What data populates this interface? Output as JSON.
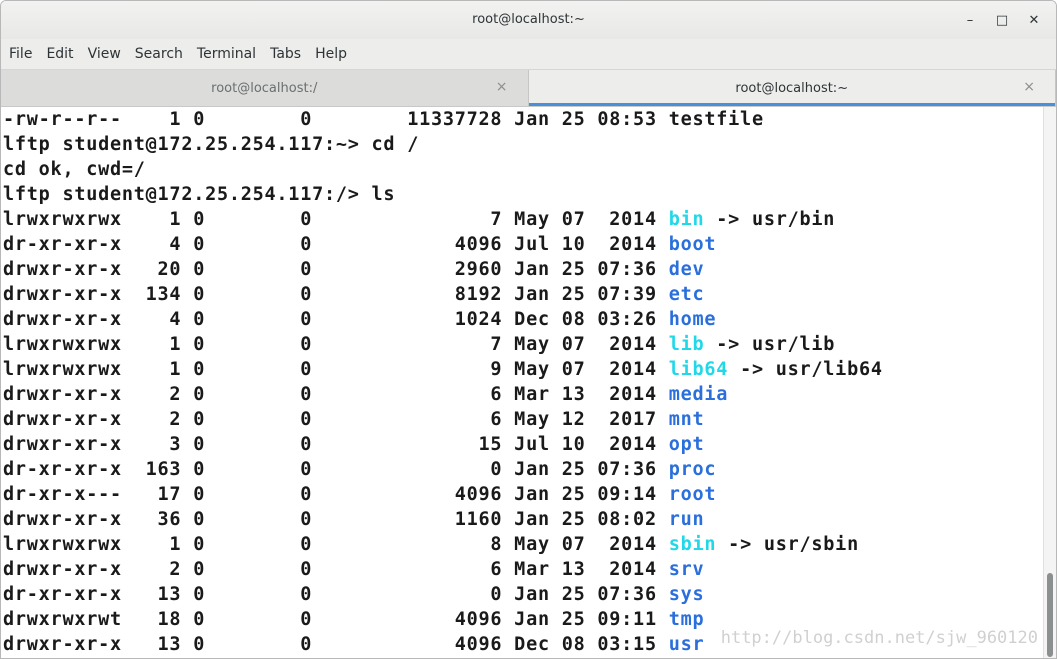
{
  "window": {
    "title": "root@localhost:~",
    "controls": {
      "minimize": "–",
      "maximize": "□",
      "close": "✕"
    }
  },
  "menu": [
    "File",
    "Edit",
    "View",
    "Search",
    "Terminal",
    "Tabs",
    "Help"
  ],
  "tabs": [
    {
      "label": "root@localhost:/",
      "close": "×",
      "active": false
    },
    {
      "label": "root@localhost:~",
      "close": "×",
      "active": true
    }
  ],
  "terminal": {
    "lines": [
      {
        "text": "-rw-r--r--    1 0        0        11337728 Jan 25 08:53 testfile"
      },
      {
        "text": "lftp student@172.25.254.117:~> cd /"
      },
      {
        "text": "cd ok, cwd=/"
      },
      {
        "text": "lftp student@172.25.254.117:/> ls"
      },
      {
        "prefix": "lrwxrwxrwx    1 0        0               7 May 07  2014 ",
        "name": "bin",
        "link": true,
        "target": " -> usr/bin"
      },
      {
        "prefix": "dr-xr-xr-x    4 0        0            4096 Jul 10  2014 ",
        "name": "boot",
        "link": false,
        "target": ""
      },
      {
        "prefix": "drwxr-xr-x   20 0        0            2960 Jan 25 07:36 ",
        "name": "dev",
        "link": false,
        "target": ""
      },
      {
        "prefix": "drwxr-xr-x  134 0        0            8192 Jan 25 07:39 ",
        "name": "etc",
        "link": false,
        "target": ""
      },
      {
        "prefix": "drwxr-xr-x    4 0        0            1024 Dec 08 03:26 ",
        "name": "home",
        "link": false,
        "target": ""
      },
      {
        "prefix": "lrwxrwxrwx    1 0        0               7 May 07  2014 ",
        "name": "lib",
        "link": true,
        "target": " -> usr/lib"
      },
      {
        "prefix": "lrwxrwxrwx    1 0        0               9 May 07  2014 ",
        "name": "lib64",
        "link": true,
        "target": " -> usr/lib64"
      },
      {
        "prefix": "drwxr-xr-x    2 0        0               6 Mar 13  2014 ",
        "name": "media",
        "link": false,
        "target": ""
      },
      {
        "prefix": "drwxr-xr-x    2 0        0               6 May 12  2017 ",
        "name": "mnt",
        "link": false,
        "target": ""
      },
      {
        "prefix": "drwxr-xr-x    3 0        0              15 Jul 10  2014 ",
        "name": "opt",
        "link": false,
        "target": ""
      },
      {
        "prefix": "dr-xr-xr-x  163 0        0               0 Jan 25 07:36 ",
        "name": "proc",
        "link": false,
        "target": ""
      },
      {
        "prefix": "dr-xr-x---   17 0        0            4096 Jan 25 09:14 ",
        "name": "root",
        "link": false,
        "target": ""
      },
      {
        "prefix": "drwxr-xr-x   36 0        0            1160 Jan 25 08:02 ",
        "name": "run",
        "link": false,
        "target": ""
      },
      {
        "prefix": "lrwxrwxrwx    1 0        0               8 May 07  2014 ",
        "name": "sbin",
        "link": true,
        "target": " -> usr/sbin"
      },
      {
        "prefix": "drwxr-xr-x    2 0        0               6 Mar 13  2014 ",
        "name": "srv",
        "link": false,
        "target": ""
      },
      {
        "prefix": "dr-xr-xr-x   13 0        0               0 Jan 25 07:36 ",
        "name": "sys",
        "link": false,
        "target": ""
      },
      {
        "prefix": "drwxrwxrwt   18 0        0            4096 Jan 25 09:11 ",
        "name": "tmp",
        "link": false,
        "target": ""
      },
      {
        "prefix": "drwxr-xr-x   13 0        0            4096 Dec 08 03:15 ",
        "name": "usr",
        "link": false,
        "target": ""
      }
    ]
  },
  "watermark": "http://blog.csdn.net/sjw_960120",
  "colors": {
    "directory": "#2a6fdb",
    "symlink": "#22d8e8",
    "active_tab_accent": "#4a90d9"
  }
}
